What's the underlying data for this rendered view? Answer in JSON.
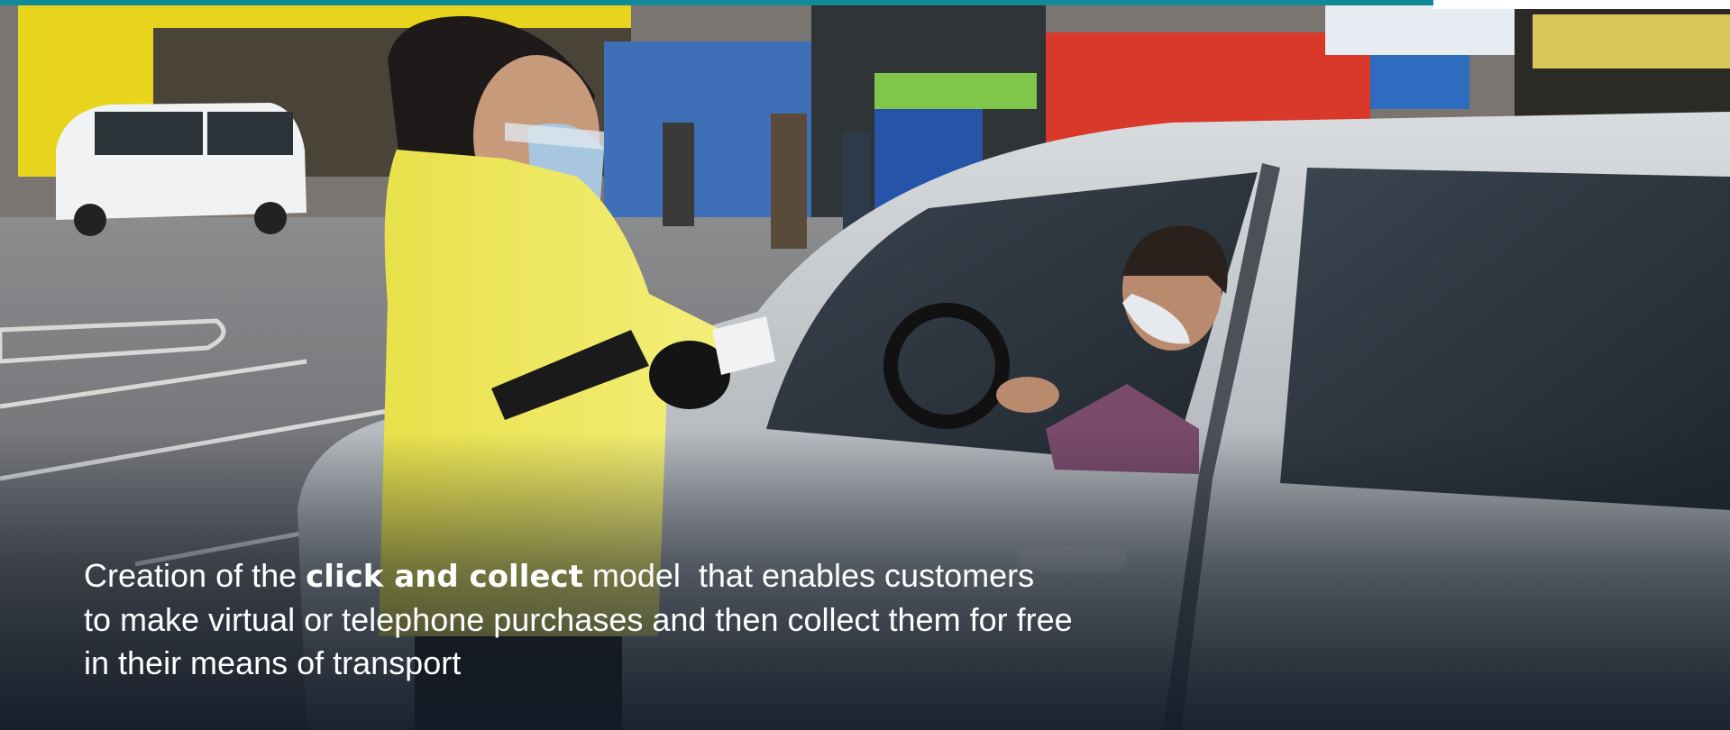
{
  "caption": {
    "line1_before": "Creation of the ",
    "line1_bold": "click and collect",
    "line1_after": " model  that enables customers",
    "line2": "to make virtual or telephone purchases and then collect them for free",
    "line3": "in their means of transport"
  },
  "colors": {
    "accent": "#0f8a96",
    "caption_text": "#ffffff",
    "overlay": "#141c28"
  }
}
